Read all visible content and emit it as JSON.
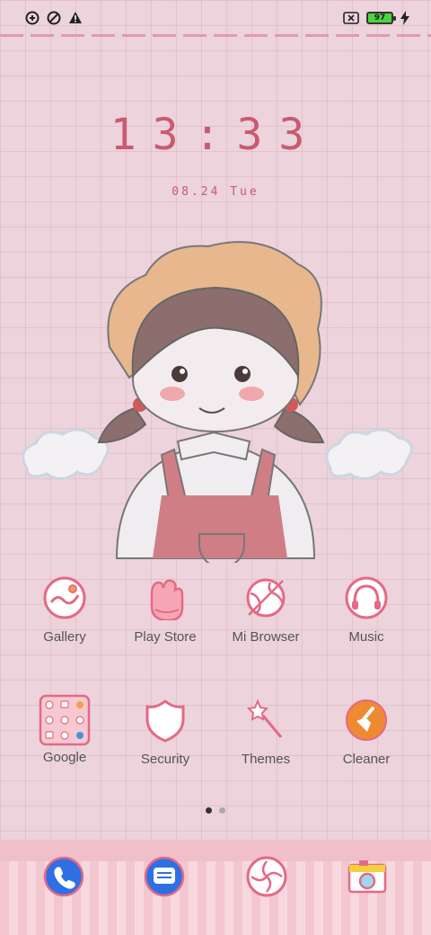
{
  "status": {
    "left_icons": [
      "nfc-blocked-icon",
      "data-saver-icon",
      "warning-icon"
    ],
    "battery_level": "97",
    "charging": true,
    "battery_color": "#4cd43f"
  },
  "lockclock": {
    "time": "13:33",
    "date": "08.24 Tue"
  },
  "theme": {
    "background": "#ecd3dc",
    "accent": "#e46a85",
    "clock_color": "#c95a70"
  },
  "apps_row1": [
    {
      "label": "Gallery",
      "icon": "gallery-icon"
    },
    {
      "label": "Play Store",
      "icon": "glove-icon"
    },
    {
      "label": "Mi Browser",
      "icon": "globe-icon"
    },
    {
      "label": "Music",
      "icon": "headphones-icon"
    }
  ],
  "apps_row2": [
    {
      "label": "Google",
      "icon": "folder-icon"
    },
    {
      "label": "Security",
      "icon": "shield-icon"
    },
    {
      "label": "Themes",
      "icon": "magic-wand-icon"
    },
    {
      "label": "Cleaner",
      "icon": "broom-icon"
    }
  ],
  "page_indicator": {
    "pages": 2,
    "current": 1
  },
  "dock": [
    {
      "icon": "phone-icon"
    },
    {
      "icon": "messages-icon"
    },
    {
      "icon": "camera-shutter-icon"
    },
    {
      "icon": "camera-icon"
    }
  ]
}
